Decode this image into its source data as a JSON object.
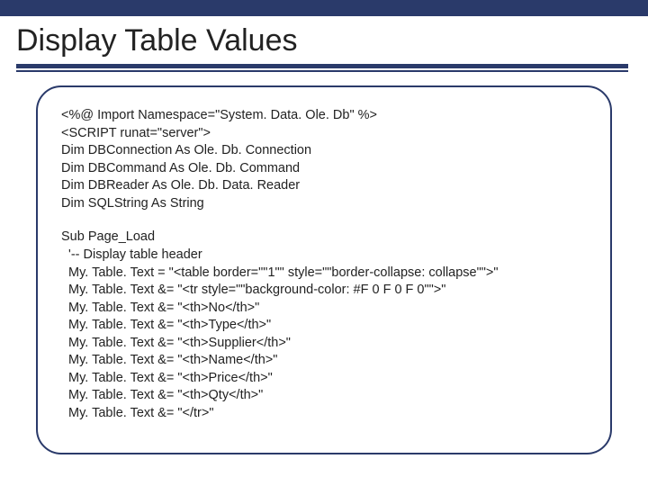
{
  "title": "Display Table Values",
  "code": {
    "block1": "<%@ Import Namespace=\"System. Data. Ole. Db\" %>\n<SCRIPT runat=\"server\">\nDim DBConnection As Ole. Db. Connection\nDim DBCommand As Ole. Db. Command\nDim DBReader As Ole. Db. Data. Reader\nDim SQLString As String",
    "block2": "Sub Page_Load\n  '-- Display table header\n  My. Table. Text = \"<table border=\"\"1\"\" style=\"\"border-collapse: collapse\"\">\"\n  My. Table. Text &= \"<tr style=\"\"background-color: #F 0 F 0 F 0\"\">\"\n  My. Table. Text &= \"<th>No</th>\"\n  My. Table. Text &= \"<th>Type</th>\"\n  My. Table. Text &= \"<th>Supplier</th>\"\n  My. Table. Text &= \"<th>Name</th>\"\n  My. Table. Text &= \"<th>Price</th>\"\n  My. Table. Text &= \"<th>Qty</th>\"\n  My. Table. Text &= \"</tr>\""
  }
}
